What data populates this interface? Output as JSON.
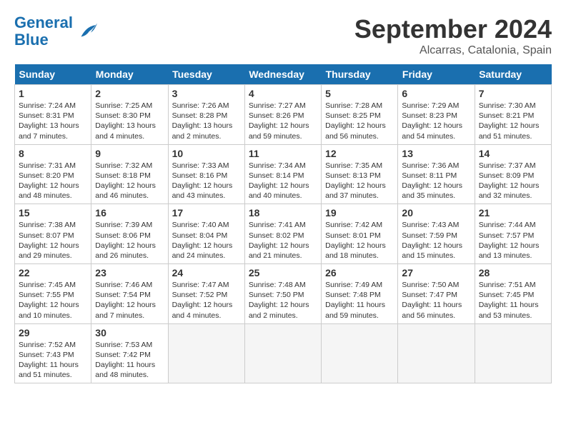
{
  "header": {
    "logo_general": "General",
    "logo_blue": "Blue",
    "month": "September 2024",
    "location": "Alcarras, Catalonia, Spain"
  },
  "days_of_week": [
    "Sunday",
    "Monday",
    "Tuesday",
    "Wednesday",
    "Thursday",
    "Friday",
    "Saturday"
  ],
  "weeks": [
    [
      {
        "day": "1",
        "sunrise": "7:24 AM",
        "sunset": "8:31 PM",
        "daylight": "13 hours and 7 minutes."
      },
      {
        "day": "2",
        "sunrise": "7:25 AM",
        "sunset": "8:30 PM",
        "daylight": "13 hours and 4 minutes."
      },
      {
        "day": "3",
        "sunrise": "7:26 AM",
        "sunset": "8:28 PM",
        "daylight": "13 hours and 2 minutes."
      },
      {
        "day": "4",
        "sunrise": "7:27 AM",
        "sunset": "8:26 PM",
        "daylight": "12 hours and 59 minutes."
      },
      {
        "day": "5",
        "sunrise": "7:28 AM",
        "sunset": "8:25 PM",
        "daylight": "12 hours and 56 minutes."
      },
      {
        "day": "6",
        "sunrise": "7:29 AM",
        "sunset": "8:23 PM",
        "daylight": "12 hours and 54 minutes."
      },
      {
        "day": "7",
        "sunrise": "7:30 AM",
        "sunset": "8:21 PM",
        "daylight": "12 hours and 51 minutes."
      }
    ],
    [
      {
        "day": "8",
        "sunrise": "7:31 AM",
        "sunset": "8:20 PM",
        "daylight": "12 hours and 48 minutes."
      },
      {
        "day": "9",
        "sunrise": "7:32 AM",
        "sunset": "8:18 PM",
        "daylight": "12 hours and 46 minutes."
      },
      {
        "day": "10",
        "sunrise": "7:33 AM",
        "sunset": "8:16 PM",
        "daylight": "12 hours and 43 minutes."
      },
      {
        "day": "11",
        "sunrise": "7:34 AM",
        "sunset": "8:14 PM",
        "daylight": "12 hours and 40 minutes."
      },
      {
        "day": "12",
        "sunrise": "7:35 AM",
        "sunset": "8:13 PM",
        "daylight": "12 hours and 37 minutes."
      },
      {
        "day": "13",
        "sunrise": "7:36 AM",
        "sunset": "8:11 PM",
        "daylight": "12 hours and 35 minutes."
      },
      {
        "day": "14",
        "sunrise": "7:37 AM",
        "sunset": "8:09 PM",
        "daylight": "12 hours and 32 minutes."
      }
    ],
    [
      {
        "day": "15",
        "sunrise": "7:38 AM",
        "sunset": "8:07 PM",
        "daylight": "12 hours and 29 minutes."
      },
      {
        "day": "16",
        "sunrise": "7:39 AM",
        "sunset": "8:06 PM",
        "daylight": "12 hours and 26 minutes."
      },
      {
        "day": "17",
        "sunrise": "7:40 AM",
        "sunset": "8:04 PM",
        "daylight": "12 hours and 24 minutes."
      },
      {
        "day": "18",
        "sunrise": "7:41 AM",
        "sunset": "8:02 PM",
        "daylight": "12 hours and 21 minutes."
      },
      {
        "day": "19",
        "sunrise": "7:42 AM",
        "sunset": "8:01 PM",
        "daylight": "12 hours and 18 minutes."
      },
      {
        "day": "20",
        "sunrise": "7:43 AM",
        "sunset": "7:59 PM",
        "daylight": "12 hours and 15 minutes."
      },
      {
        "day": "21",
        "sunrise": "7:44 AM",
        "sunset": "7:57 PM",
        "daylight": "12 hours and 13 minutes."
      }
    ],
    [
      {
        "day": "22",
        "sunrise": "7:45 AM",
        "sunset": "7:55 PM",
        "daylight": "12 hours and 10 minutes."
      },
      {
        "day": "23",
        "sunrise": "7:46 AM",
        "sunset": "7:54 PM",
        "daylight": "12 hours and 7 minutes."
      },
      {
        "day": "24",
        "sunrise": "7:47 AM",
        "sunset": "7:52 PM",
        "daylight": "12 hours and 4 minutes."
      },
      {
        "day": "25",
        "sunrise": "7:48 AM",
        "sunset": "7:50 PM",
        "daylight": "12 hours and 2 minutes."
      },
      {
        "day": "26",
        "sunrise": "7:49 AM",
        "sunset": "7:48 PM",
        "daylight": "11 hours and 59 minutes."
      },
      {
        "day": "27",
        "sunrise": "7:50 AM",
        "sunset": "7:47 PM",
        "daylight": "11 hours and 56 minutes."
      },
      {
        "day": "28",
        "sunrise": "7:51 AM",
        "sunset": "7:45 PM",
        "daylight": "11 hours and 53 minutes."
      }
    ],
    [
      {
        "day": "29",
        "sunrise": "7:52 AM",
        "sunset": "7:43 PM",
        "daylight": "11 hours and 51 minutes."
      },
      {
        "day": "30",
        "sunrise": "7:53 AM",
        "sunset": "7:42 PM",
        "daylight": "11 hours and 48 minutes."
      },
      null,
      null,
      null,
      null,
      null
    ]
  ]
}
